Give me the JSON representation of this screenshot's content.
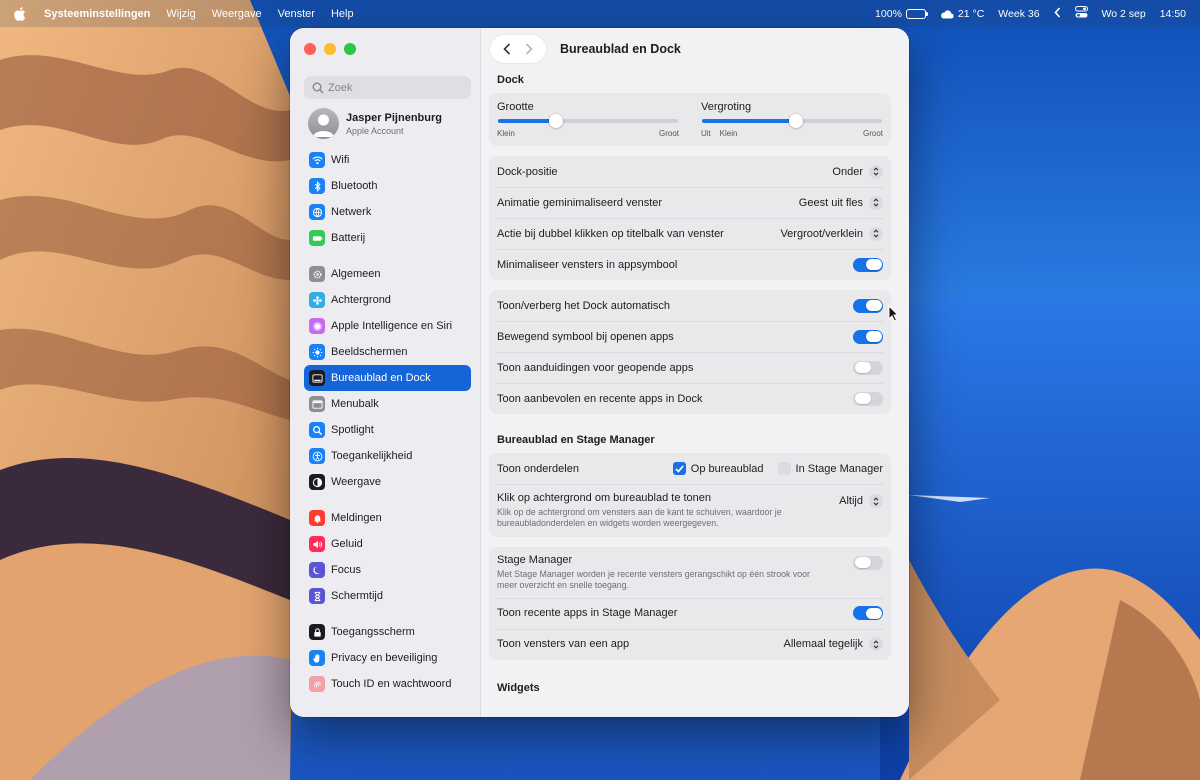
{
  "menubar": {
    "app_name": "Systeeminstellingen",
    "menus": [
      "Wijzig",
      "Weergave",
      "Venster",
      "Help"
    ],
    "battery_percent": "100%",
    "battery_level": 1.0,
    "weather": "21 °C",
    "week": "Week 36",
    "date": "Wo 2 sep",
    "time": "14:50"
  },
  "sidebar": {
    "search_placeholder": "Zoek",
    "account": {
      "name": "Jasper Pijnenburg",
      "subtitle": "Apple Account"
    },
    "groups": [
      [
        {
          "label": "Wifi",
          "icon": "wifi-icon",
          "color": "#1a82f5"
        },
        {
          "label": "Bluetooth",
          "icon": "bluetooth-icon",
          "color": "#1a82f5"
        },
        {
          "label": "Netwerk",
          "icon": "globe-icon",
          "color": "#1a82f5"
        },
        {
          "label": "Batterij",
          "icon": "battery-icon",
          "color": "#34c759"
        }
      ],
      [
        {
          "label": "Algemeen",
          "icon": "gear-icon",
          "color": "#8e8e93"
        },
        {
          "label": "Achtergrond",
          "icon": "flower-icon",
          "color": "#32ade6"
        },
        {
          "label": "Apple Intelligence en Siri",
          "icon": "siri-icon",
          "color": "#c56cf0"
        },
        {
          "label": "Beeldschermen",
          "icon": "sun-icon",
          "color": "#1a82f5"
        },
        {
          "label": "Bureaublad en Dock",
          "icon": "dock-icon",
          "color": "#1c1c1e",
          "active": true
        },
        {
          "label": "Menubalk",
          "icon": "menubar-icon",
          "color": "#8e8e93"
        },
        {
          "label": "Spotlight",
          "icon": "magnifier-icon",
          "color": "#1a82f5"
        },
        {
          "label": "Toegankelijkheid",
          "icon": "accessibility-icon",
          "color": "#1a82f5"
        },
        {
          "label": "Weergave",
          "icon": "appearance-icon",
          "color": "#1c1c1e"
        }
      ],
      [
        {
          "label": "Meldingen",
          "icon": "bell-icon",
          "color": "#ff3b30"
        },
        {
          "label": "Geluid",
          "icon": "speaker-icon",
          "color": "#ff2d55"
        },
        {
          "label": "Focus",
          "icon": "moon-icon",
          "color": "#5856d6"
        },
        {
          "label": "Schermtijd",
          "icon": "hourglass-icon",
          "color": "#5856d6"
        }
      ],
      [
        {
          "label": "Toegangsscherm",
          "icon": "lockscreen-icon",
          "color": "#1c1c1e"
        },
        {
          "label": "Privacy en beveiliging",
          "icon": "hand-icon",
          "color": "#1a82f5"
        },
        {
          "label": "Touch ID en wachtwoord",
          "icon": "fingerprint-icon",
          "color": "#f5a0a8"
        }
      ]
    ]
  },
  "content": {
    "title": "Bureaublad en Dock",
    "dock_section": "Dock",
    "sliders": [
      {
        "label": "Grootte",
        "min_label": "Klein",
        "max_label": "Groot",
        "value": 0.32
      },
      {
        "label": "Vergroting",
        "off_label": "Uit",
        "min_label": "Klein",
        "max_label": "Groot",
        "value": 0.52
      }
    ],
    "dock_settings": [
      {
        "label": "Dock-positie",
        "type": "popup",
        "value": "Onder"
      },
      {
        "label": "Animatie geminimaliseerd venster",
        "type": "popup",
        "value": "Geest uit fles"
      },
      {
        "label": "Actie bij dubbel klikken op titelbalk van venster",
        "type": "popup",
        "value": "Vergroot/verklein"
      },
      {
        "label": "Minimaliseer vensters in appsymbool",
        "type": "toggle",
        "value": true
      }
    ],
    "dock_toggles": [
      {
        "label": "Toon/verberg het Dock automatisch",
        "value": true
      },
      {
        "label": "Bewegend symbool bij openen apps",
        "value": true
      },
      {
        "label": "Toon aanduidingen voor geopende apps",
        "value": false
      },
      {
        "label": "Toon aanbevolen en recente apps in Dock",
        "value": false
      }
    ],
    "stage_section": "Bureaublad en Stage Manager",
    "show_items": {
      "label": "Toon onderdelen",
      "opt1": "Op bureaublad",
      "opt1_checked": true,
      "opt2": "In Stage Manager",
      "opt2_checked": false
    },
    "click_wallpaper": {
      "label": "Klik op achtergrond om bureaublad te tonen",
      "desc": "Klik op de achtergrond om vensters aan de kant te schuiven, waardoor je bureaubladonderdelen en widgets worden weergegeven.",
      "value": "Altijd"
    },
    "stage_manager": {
      "label": "Stage Manager",
      "desc": "Met Stage Manager worden je recente vensters gerangschikt op één strook voor meer overzicht en snelle toegang.",
      "value": false
    },
    "recent_apps": {
      "label": "Toon recente apps in Stage Manager",
      "value": true
    },
    "app_windows": {
      "label": "Toon vensters van een app",
      "value": "Allemaal tegelijk"
    },
    "widgets_section": "Widgets"
  }
}
